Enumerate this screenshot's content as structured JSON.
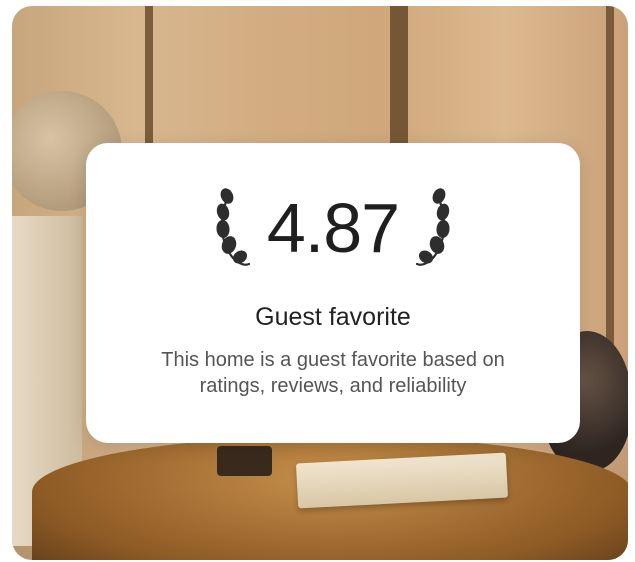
{
  "listing_card": {
    "rating": "4.87",
    "title": "Guest favorite",
    "description": "This home is a guest favorite based on ratings, reviews, and reliability"
  },
  "icons": {
    "left": "laurel-left-icon",
    "right": "laurel-right-icon"
  },
  "colors": {
    "rating_text": "#1f1f1f",
    "title_text": "#222222",
    "description_text": "#555555",
    "popup_background": "#ffffff"
  }
}
